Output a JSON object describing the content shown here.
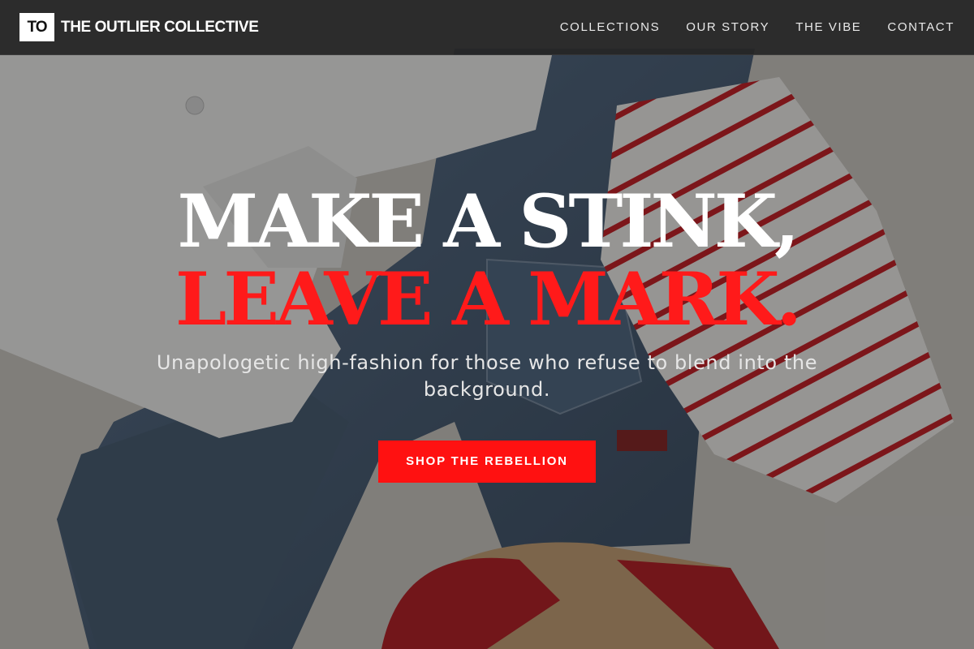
{
  "header": {
    "logo_mark": "TO",
    "brand_name": "THE OUTLIER COLLECTIVE",
    "nav": [
      {
        "label": "COLLECTIONS"
      },
      {
        "label": "OUR STORY"
      },
      {
        "label": "THE VIBE"
      },
      {
        "label": "CONTACT"
      }
    ]
  },
  "hero": {
    "headline_line_1": "MAKE A STINK,",
    "headline_line_2": "LEAVE A MARK.",
    "subheadline": "Unapologetic high-fashion for those who refuse to blend into the background.",
    "cta_label": "SHOP THE REBELLION",
    "background_image": "flat-lay-clothing-photo"
  },
  "colors": {
    "accent": "#ff1a1a",
    "header_bg": "#262626",
    "text_light": "#ffffff"
  }
}
